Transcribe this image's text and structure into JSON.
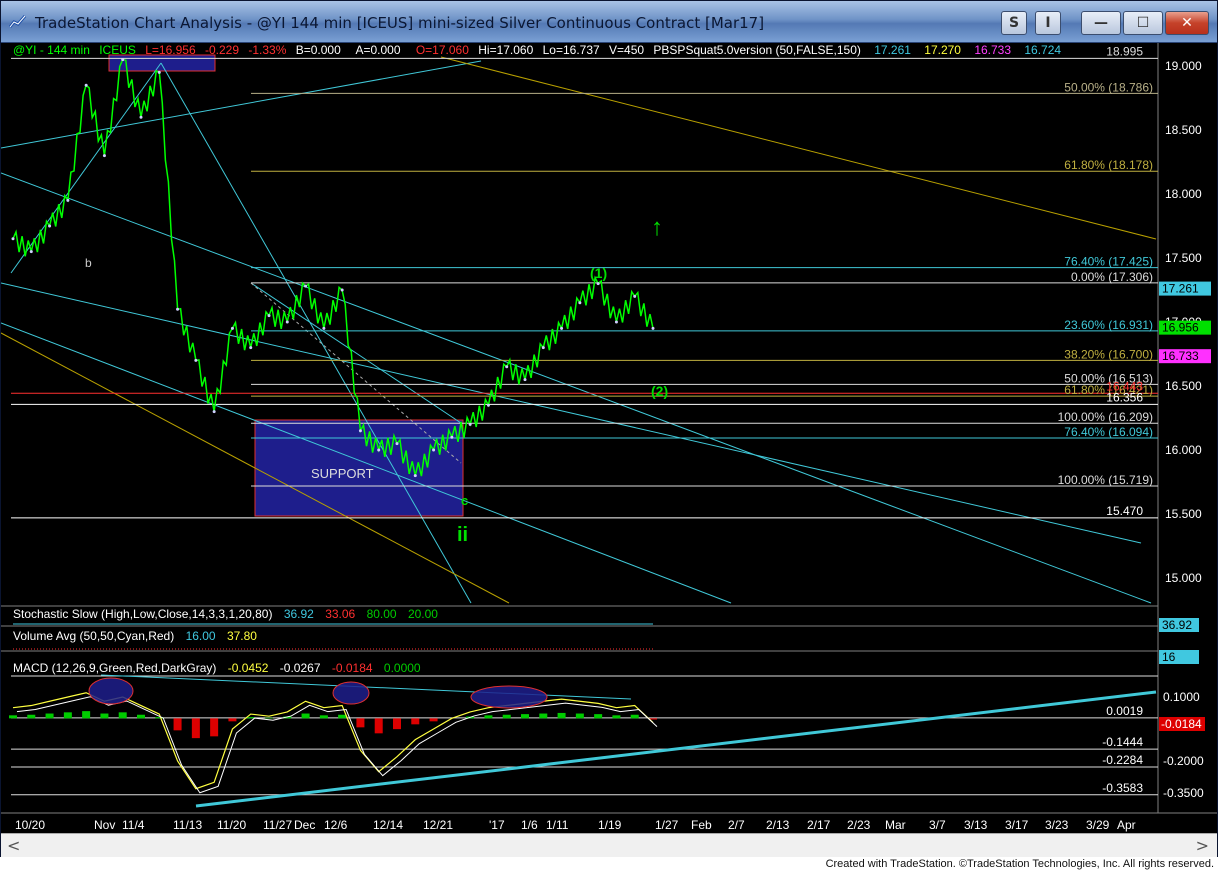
{
  "window": {
    "title": "TradeStation Chart Analysis - @YI 144 min [ICEUS] mini-sized Silver Continuous Contract [Mar17]",
    "btn_s": "S",
    "btn_i": "I",
    "btn_min": "—",
    "btn_max": "☐",
    "btn_close": "✕"
  },
  "footer": "Created with TradeStation. ©TradeStation Technologies, Inc. All rights reserved.",
  "colors": {
    "background": "#000000",
    "price": "#00ff00",
    "trendline": "#40c8d8",
    "fib_yellow": "#b8a000",
    "support_box": "#1e1e8c",
    "macd_hist_pos": "#00cc00",
    "macd_hist_neg": "#dd0000"
  },
  "header": {
    "symbol": "@YI - 144 min",
    "exchange": "ICEUS",
    "last": "L=16.956",
    "change": "-0.229",
    "pct": "-1.33%",
    "bid": "B=0.000",
    "ask": "A=0.000",
    "open": "O=17.060",
    "high": "Hi=17.060",
    "low": "Lo=16.737",
    "volume": "V=450",
    "study": "PBSPSquat5.0version (50,FALSE,150)",
    "v1": "17.261",
    "v2": "17.270",
    "v3": "16.733",
    "v4": "16.724"
  },
  "price_axis": [
    "19.000",
    "18.500",
    "18.000",
    "17.500",
    "17.000",
    "16.500",
    "16.000",
    "15.500",
    "15.000"
  ],
  "fib_labels": [
    {
      "text": "50.00% (18.786)",
      "price": 18.786,
      "color": "#b8b088"
    },
    {
      "text": "61.80% (18.178)",
      "price": 18.178,
      "color": "#c0b040"
    },
    {
      "text": "76.40% (17.425)",
      "price": 17.425,
      "color": "#40c8d8"
    },
    {
      "text": "0.00% (17.306)",
      "price": 17.306,
      "color": "#dddddd"
    },
    {
      "text": "23.60% (16.931)",
      "price": 16.931,
      "color": "#40c8d8"
    },
    {
      "text": "38.20% (16.700)",
      "price": 16.7,
      "color": "#c0b040"
    },
    {
      "text": "50.00% (16.513)",
      "price": 16.513,
      "color": "#dddddd"
    },
    {
      "text": "61.80% (16.421)",
      "price": 16.421,
      "color": "#c0b040"
    },
    {
      "text": "100.00% (16.209)",
      "price": 16.209,
      "color": "#dddddd"
    },
    {
      "text": "76.40% (16.094)",
      "price": 16.094,
      "color": "#40c8d8"
    },
    {
      "text": "100.00% (15.719)",
      "price": 15.719,
      "color": "#dddddd"
    }
  ],
  "extra_levels": [
    {
      "text": "16.356",
      "price": 16.356,
      "color": "#ffffff"
    },
    {
      "text": "16.443",
      "price": 16.443,
      "color": "#ff3030"
    },
    {
      "text": "15.470",
      "price": 15.47,
      "color": "#ffffff"
    },
    {
      "text": "18.995",
      "price": 19.06,
      "color": "#dddddd"
    }
  ],
  "price_tags": [
    {
      "text": "17.261",
      "price": 17.261,
      "bg": "#40c8e0",
      "fg": "#000"
    },
    {
      "text": "16.956",
      "price": 16.956,
      "bg": "#00e000",
      "fg": "#000"
    },
    {
      "text": "16.733",
      "price": 16.733,
      "bg": "#ff30ff",
      "fg": "#000"
    }
  ],
  "annotations": {
    "support": "SUPPORT",
    "wave_b": "b",
    "wave_c": "c",
    "wave_ii": "ii",
    "wave_1": "(1)",
    "wave_2": "(2)",
    "arrow_up": "↑"
  },
  "stochastic": {
    "label": "Stochastic Slow (High,Low,Close,14,3,3,1,20,80)",
    "v1": "36.92",
    "v2": "33.06",
    "v3": "80.00",
    "v4": "20.00",
    "tag": "36.92"
  },
  "volume": {
    "label": "Volume Avg (50,50,Cyan,Red)",
    "v1": "16.00",
    "v2": "37.80",
    "tag": "16"
  },
  "macd": {
    "label": "MACD (12,26,9,Green,Red,DarkGray)",
    "v1": "-0.0452",
    "v2": "-0.0267",
    "v3": "-0.0184",
    "v4": "0.0000",
    "axis": [
      "0.1000",
      "-0.2000",
      "-0.3500"
    ],
    "levels": [
      {
        "text": "0.0019",
        "value": 0.0019,
        "color": "#ffffff"
      },
      {
        "text": "-0.1444",
        "value": -0.1444,
        "color": "#ffffff"
      },
      {
        "text": "-0.2284",
        "value": -0.2284,
        "color": "#ffffff"
      },
      {
        "text": "-0.3583",
        "value": -0.3583,
        "color": "#ffffff"
      }
    ],
    "tag": "-0.0184"
  },
  "date_axis": [
    "10/20",
    "Nov",
    "11/4",
    "11/13",
    "11/20",
    "11/27",
    "Dec",
    "12/6",
    "12/14",
    "12/21",
    "'17",
    "1/6",
    "1/11",
    "1/19",
    "1/27",
    "Feb",
    "2/7",
    "2/13",
    "2/17",
    "2/23",
    "Mar",
    "3/7",
    "3/13",
    "3/17",
    "3/23",
    "3/29",
    "Apr"
  ],
  "chart_data": {
    "type": "line",
    "title": "@YI 144 min [ICEUS] mini-sized Silver Continuous Contract [Mar17]",
    "xlabel": "",
    "ylabel": "",
    "ylim": [
      14.8,
      19.1
    ],
    "grid": false,
    "series": [
      {
        "name": "@YI",
        "x": [
          "10/20",
          "10/25",
          "10/28",
          "Nov",
          "11/4",
          "11/7",
          "11/9",
          "11/11",
          "11/13",
          "11/15",
          "11/17",
          "11/20",
          "11/23",
          "11/27",
          "Dec",
          "12/2",
          "12/6",
          "12/8",
          "12/12",
          "12/14",
          "12/16",
          "12/19",
          "12/21",
          "12/23",
          "12/27",
          "12/30",
          "'17",
          "1/4",
          "1/6",
          "1/9",
          "1/11",
          "1/13",
          "1/17",
          "1/19",
          "1/23",
          "1/25"
        ],
        "values": [
          17.65,
          17.55,
          17.75,
          17.95,
          18.85,
          18.3,
          19.05,
          18.6,
          18.95,
          17.1,
          16.7,
          16.3,
          16.95,
          16.8,
          17.05,
          17.0,
          17.28,
          16.95,
          17.25,
          16.15,
          16.0,
          16.05,
          15.8,
          16.0,
          16.1,
          16.2,
          16.35,
          16.65,
          16.55,
          16.8,
          16.95,
          17.15,
          17.3,
          17.0,
          17.2,
          16.95
        ]
      }
    ],
    "macd_series": {
      "name": "MACD",
      "values": [
        0.05,
        0.06,
        0.08,
        0.1,
        0.12,
        0.08,
        0.1,
        0.06,
        0.02,
        -0.2,
        -0.33,
        -0.3,
        -0.05,
        0.02,
        0.01,
        0.03,
        0.08,
        0.05,
        0.06,
        -0.15,
        -0.25,
        -0.18,
        -0.1,
        -0.05,
        0.0,
        0.03,
        0.05,
        0.06,
        0.07,
        0.08,
        0.09,
        0.08,
        0.07,
        0.05,
        0.06,
        -0.02
      ]
    }
  }
}
